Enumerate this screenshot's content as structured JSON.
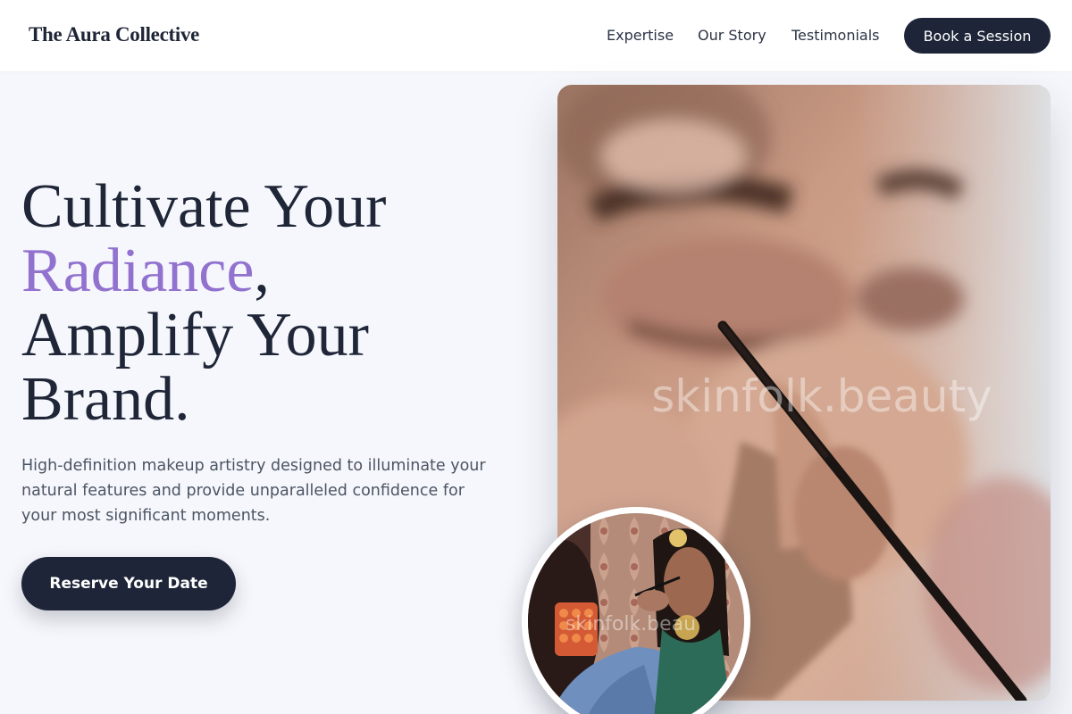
{
  "header": {
    "brand": "The Aura Collective",
    "nav": [
      "Expertise",
      "Our Story",
      "Testimonials"
    ],
    "cta_label": "Book a Session"
  },
  "hero": {
    "title_line1": "Cultivate Your",
    "title_accent": "Radiance",
    "title_comma": ",",
    "title_line3": "Amplify Your",
    "title_line4": "Brand.",
    "subtitle": "High-definition makeup artistry designed to illuminate your natural features and provide unparalleled confidence for your most significant moments.",
    "cta_label": "Reserve Your Date"
  },
  "images": {
    "main_watermark": "skinfolk.beauty",
    "inset_watermark": "skinfolk.beau"
  },
  "colors": {
    "primary": "#1e2538",
    "accent": "#9272cf",
    "background": "#f6f7fc"
  }
}
